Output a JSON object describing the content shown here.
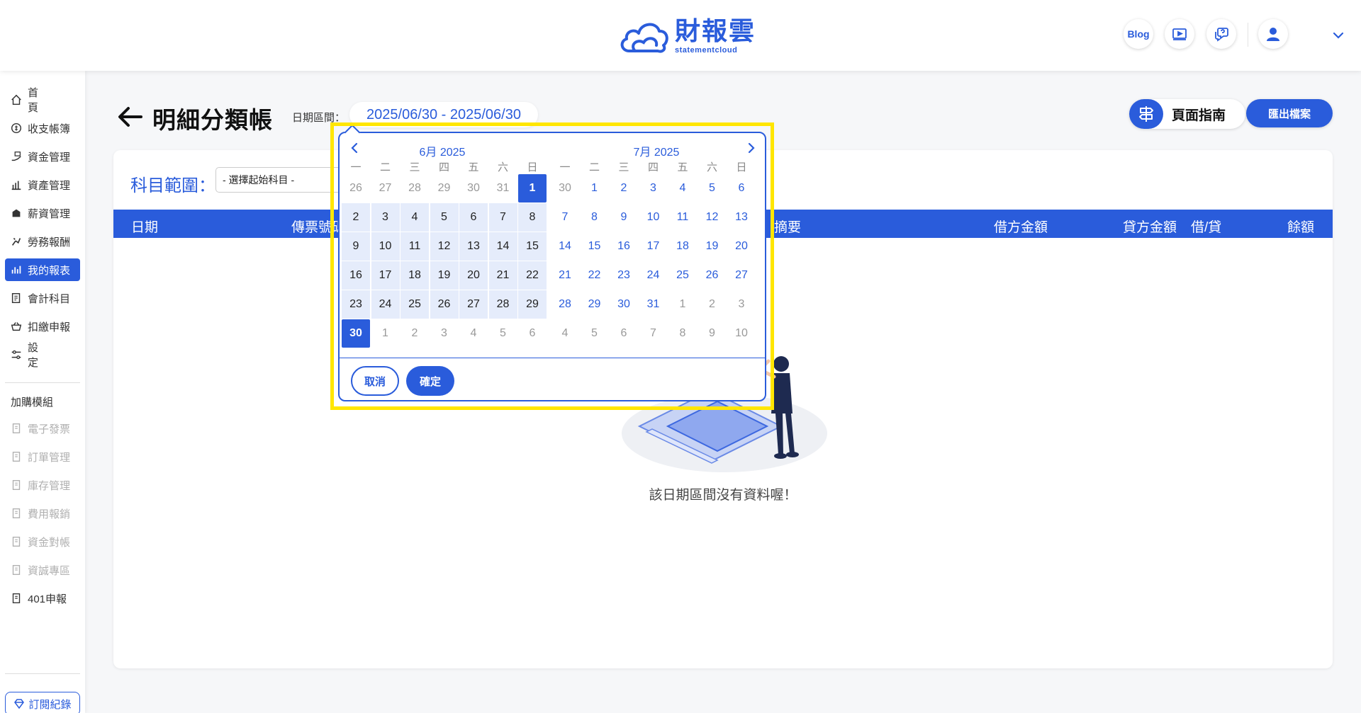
{
  "header": {
    "brand_cn": "財報雲",
    "brand_en": "statementcloud",
    "blog_label": "Blog"
  },
  "sidebar": {
    "items": [
      {
        "label": "首頁",
        "icon": "home-icon",
        "active": false,
        "muted": false,
        "spaced": true
      },
      {
        "label": "收支帳簿",
        "icon": "coin-icon",
        "active": false,
        "muted": false,
        "spaced": false
      },
      {
        "label": "資金管理",
        "icon": "money-hand-icon",
        "active": false,
        "muted": false,
        "spaced": false
      },
      {
        "label": "資產管理",
        "icon": "asset-icon",
        "active": false,
        "muted": false,
        "spaced": false
      },
      {
        "label": "薪資管理",
        "icon": "salary-icon",
        "active": false,
        "muted": false,
        "spaced": false
      },
      {
        "label": "勞務報酬",
        "icon": "labor-icon",
        "active": false,
        "muted": false,
        "spaced": false
      },
      {
        "label": "我的報表",
        "icon": "chart-icon",
        "active": true,
        "muted": false,
        "spaced": false
      },
      {
        "label": "會計科目",
        "icon": "ledger-icon",
        "active": false,
        "muted": false,
        "spaced": false
      },
      {
        "label": "扣繳申報",
        "icon": "basket-icon",
        "active": false,
        "muted": false,
        "spaced": false
      },
      {
        "label": "設定",
        "icon": "settings-icon",
        "active": false,
        "muted": false,
        "spaced": true
      }
    ],
    "addon_title": "加購模組",
    "addons": [
      {
        "label": "電子發票",
        "muted": true
      },
      {
        "label": "訂單管理",
        "muted": true
      },
      {
        "label": "庫存管理",
        "muted": true
      },
      {
        "label": "費用報銷",
        "muted": true
      },
      {
        "label": "資金對帳",
        "muted": true
      },
      {
        "label": "資誠專區",
        "muted": true
      },
      {
        "label": "401申報",
        "muted": false
      }
    ],
    "subscription_label": "訂閱紀錄"
  },
  "page": {
    "title": "明細分類帳",
    "date_label": "日期區間：",
    "date_range": "2025/06/30 - 2025/06/30",
    "guide_label": "頁面指南",
    "export_label": "匯出檔案"
  },
  "filter": {
    "scope_label": "科目範圍：",
    "select_value": "- 選擇起始科目 -"
  },
  "table": {
    "columns": [
      {
        "label": "日期"
      },
      {
        "label": "傳票號碼"
      },
      {
        "label": "摘要"
      },
      {
        "label": "借方金額"
      },
      {
        "label": "貸方金額"
      },
      {
        "label": "借/貸"
      },
      {
        "label": "餘額"
      }
    ],
    "empty_message": "該日期區間沒有資料喔！"
  },
  "datepicker": {
    "left_month": "6月 2025",
    "right_month": "7月 2025",
    "weekdays": [
      "一",
      "二",
      "三",
      "四",
      "五",
      "六",
      "日"
    ],
    "left_days": [
      [
        26,
        27,
        28,
        29,
        30,
        31,
        1
      ],
      [
        2,
        3,
        4,
        5,
        6,
        7,
        8
      ],
      [
        9,
        10,
        11,
        12,
        13,
        14,
        15
      ],
      [
        16,
        17,
        18,
        19,
        20,
        21,
        22
      ],
      [
        23,
        24,
        25,
        26,
        27,
        28,
        29
      ],
      [
        30,
        1,
        2,
        3,
        4,
        5,
        6
      ]
    ],
    "right_days": [
      [
        30,
        1,
        2,
        3,
        4,
        5,
        6
      ],
      [
        7,
        8,
        9,
        10,
        11,
        12,
        13
      ],
      [
        14,
        15,
        16,
        17,
        18,
        19,
        20
      ],
      [
        21,
        22,
        23,
        24,
        25,
        26,
        27
      ],
      [
        28,
        29,
        30,
        31,
        1,
        2,
        3
      ],
      [
        4,
        5,
        6,
        7,
        8,
        9,
        10
      ]
    ],
    "selected_start": 1,
    "selected_end": 30,
    "cancel_label": "取消",
    "confirm_label": "確定"
  },
  "colors": {
    "accent": "#2a5cdb",
    "highlight": "#ffe600",
    "range": "#e5ecfb"
  }
}
